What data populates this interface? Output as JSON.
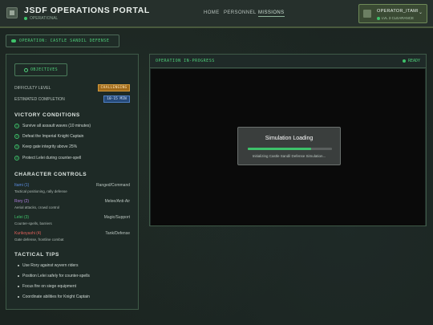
{
  "header": {
    "title": "JSDF OPERATIONS PORTAL",
    "status": "OPERATIONAL",
    "nav": [
      "HOME",
      "PERSONNEL",
      "MISSIONS"
    ],
    "active_nav": "MISSIONS",
    "operator": {
      "name": "OPERATOR_ITAMI",
      "level": "LVL 3 CLEARANCE"
    }
  },
  "operation_tag": "OPERATION: CASTLE SANDIL DEFENSE",
  "objectives": {
    "button": "OBJECTIVES",
    "difficulty_label": "DIFFICULTY LEVEL",
    "difficulty_value": "CHALLENGING",
    "completion_label": "ESTIMATED COMPLETION",
    "completion_value": "10-15 MIN"
  },
  "victory": {
    "title": "VICTORY CONDITIONS",
    "items": [
      {
        "n": "1",
        "text": "Survive all assault waves (10 minutes)"
      },
      {
        "n": "2",
        "text": "Defeat the Imperial Knight Captain"
      },
      {
        "n": "3",
        "text": "Keep gate integrity above 25%"
      },
      {
        "n": "4",
        "text": "Protect Lelei during counter-spell"
      }
    ]
  },
  "characters": {
    "title": "CHARACTER CONTROLS",
    "items": [
      {
        "name": "Itami (1)",
        "role": "Ranged/Command",
        "desc": "Tactical positioning, rally defense",
        "color": "#5b8de0"
      },
      {
        "name": "Rory (2)",
        "role": "Melee/Anti-Air",
        "desc": "Aerial attacks, crowd control",
        "color": "#b07de0"
      },
      {
        "name": "Lelei (3)",
        "role": "Magic/Support",
        "desc": "Counter-spells, barriers",
        "color": "#3ec26a"
      },
      {
        "name": "Kurikoyashi (4)",
        "role": "Tank/Defense",
        "desc": "Gate defense, frontline combat",
        "color": "#e0605a"
      }
    ]
  },
  "tips": {
    "title": "TACTICAL TIPS",
    "items": [
      "Use Rory against wyvern riders",
      "Position Lelei safely for counter-spells",
      "Focus fire on siege equipment",
      "Coordinate abilities for Knight Captain"
    ]
  },
  "simulation": {
    "header": "OPERATION IN-PROGRESS",
    "ready": "READY",
    "modal_title": "Simulation Loading",
    "modal_sub": "Initializing Castle Sandil Defense Simulation...",
    "progress": 0.75
  },
  "colors": {
    "accent": "#3ec26a",
    "orange": "#a06a1a",
    "blue": "#264a7a"
  }
}
